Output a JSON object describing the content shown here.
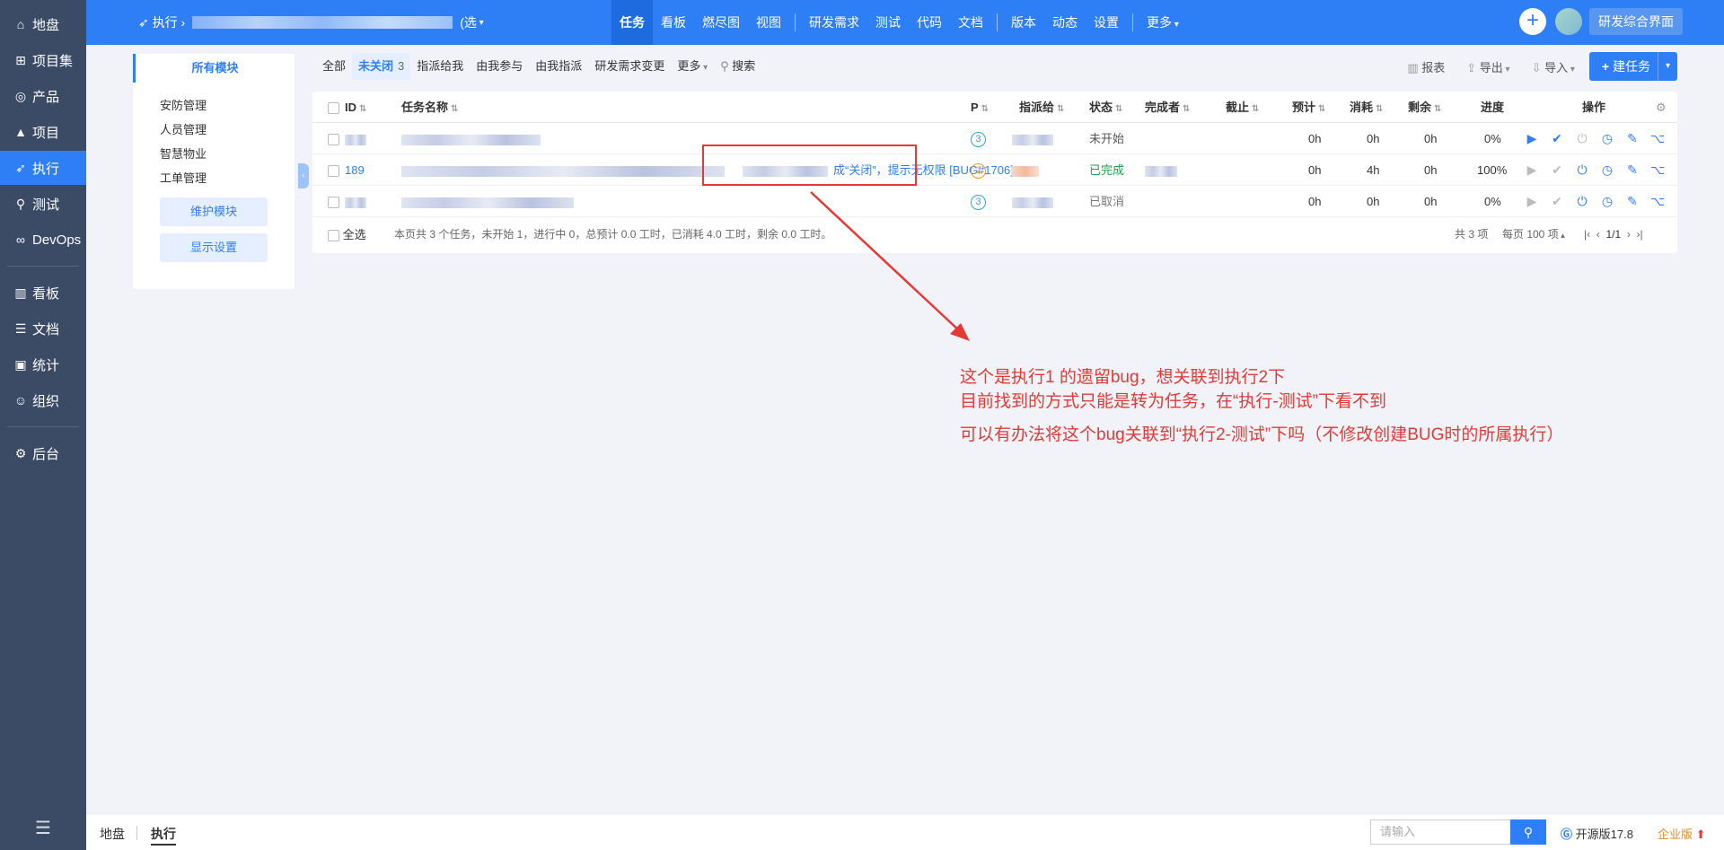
{
  "sidebar": {
    "items": [
      {
        "label": "地盘",
        "icon": "home-icon"
      },
      {
        "label": "项目集",
        "icon": "grid-icon"
      },
      {
        "label": "产品",
        "icon": "lightbulb-icon"
      },
      {
        "label": "项目",
        "icon": "rocket-icon"
      },
      {
        "label": "执行",
        "icon": "run-icon"
      },
      {
        "label": "测试",
        "icon": "search-icon"
      },
      {
        "label": "DevOps",
        "icon": "infinity-icon"
      },
      {
        "label": "看板",
        "icon": "board-icon"
      },
      {
        "label": "文档",
        "icon": "doc-icon"
      },
      {
        "label": "统计",
        "icon": "chart-icon"
      },
      {
        "label": "组织",
        "icon": "user-icon"
      },
      {
        "label": "后台",
        "icon": "gear-icon"
      }
    ]
  },
  "topbar": {
    "breadcrumb_first": "执行",
    "breadcrumb_select": "(选",
    "nav": [
      "任务",
      "看板",
      "燃尽图",
      "视图",
      "研发需求",
      "测试",
      "代码",
      "文档",
      "版本",
      "动态",
      "设置",
      "更多"
    ],
    "rd_button": "研发综合界面"
  },
  "modules": {
    "title": "所有模块",
    "items": [
      "安防管理",
      "人员管理",
      "智慧物业",
      "工单管理"
    ],
    "maintain_button": "维护模块",
    "display_button": "显示设置"
  },
  "filters": {
    "all": "全部",
    "unclosed": "未关闭",
    "unclosed_count": "3",
    "assigned_to_me": "指派给我",
    "joined": "由我参与",
    "assigned_by_me": "由我指派",
    "req_change": "研发需求变更",
    "more": "更多",
    "search": "搜索"
  },
  "tools": {
    "report": "报表",
    "export": "导出",
    "import": "导入",
    "create": "建任务"
  },
  "table": {
    "headers": {
      "id": "ID",
      "name": "任务名称",
      "pri": "P",
      "assigned": "指派给",
      "status": "状态",
      "finished_by": "完成者",
      "deadline": "截止",
      "estimate": "预计",
      "consumed": "消耗",
      "left": "剩余",
      "progress": "进度",
      "actions": "操作"
    },
    "rows": [
      {
        "id": "",
        "name_tail": "",
        "pri": "3",
        "status": "未开始",
        "estimate": "0h",
        "consumed": "0h",
        "left": "0h",
        "progress": "0%"
      },
      {
        "id": "189",
        "name_tail": "成“关闭”，提示无权限 [BUG#1706]",
        "pri": "2",
        "status": "已完成",
        "estimate": "0h",
        "consumed": "4h",
        "left": "0h",
        "progress": "100%"
      },
      {
        "id": "",
        "name_tail": "",
        "pri": "3",
        "status": "已取消",
        "estimate": "0h",
        "consumed": "0h",
        "left": "0h",
        "progress": "0%"
      }
    ],
    "footer": {
      "select_all": "全选",
      "summary": "本页共 3 个任务，未开始 1，进行中 0，总预计 0.0 工时，已消耗 4.0 工时，剩余 0.0 工时。",
      "total": "共 3 项",
      "per_page": "每页 100 项",
      "page": "1/1"
    }
  },
  "annotation": {
    "line1": "这个是执行1 的遗留bug，想关联到执行2下",
    "line2": "目前找到的方式只能是转为任务，在“执行-测试”下看不到",
    "line3": "可以有办法将这个bug关联到“执行2-测试”下吗（不修改创建BUG时的所属执行）"
  },
  "bottombar": {
    "crumb_home": "地盘",
    "crumb_current": "执行",
    "search_placeholder": "请输入",
    "version": "开源版17.8",
    "enterprise": "企业版"
  },
  "colors": {
    "accent": "#2e7ef6",
    "sidebar": "#3b4b66",
    "annotation": "#e53935",
    "done": "#16a34a"
  }
}
